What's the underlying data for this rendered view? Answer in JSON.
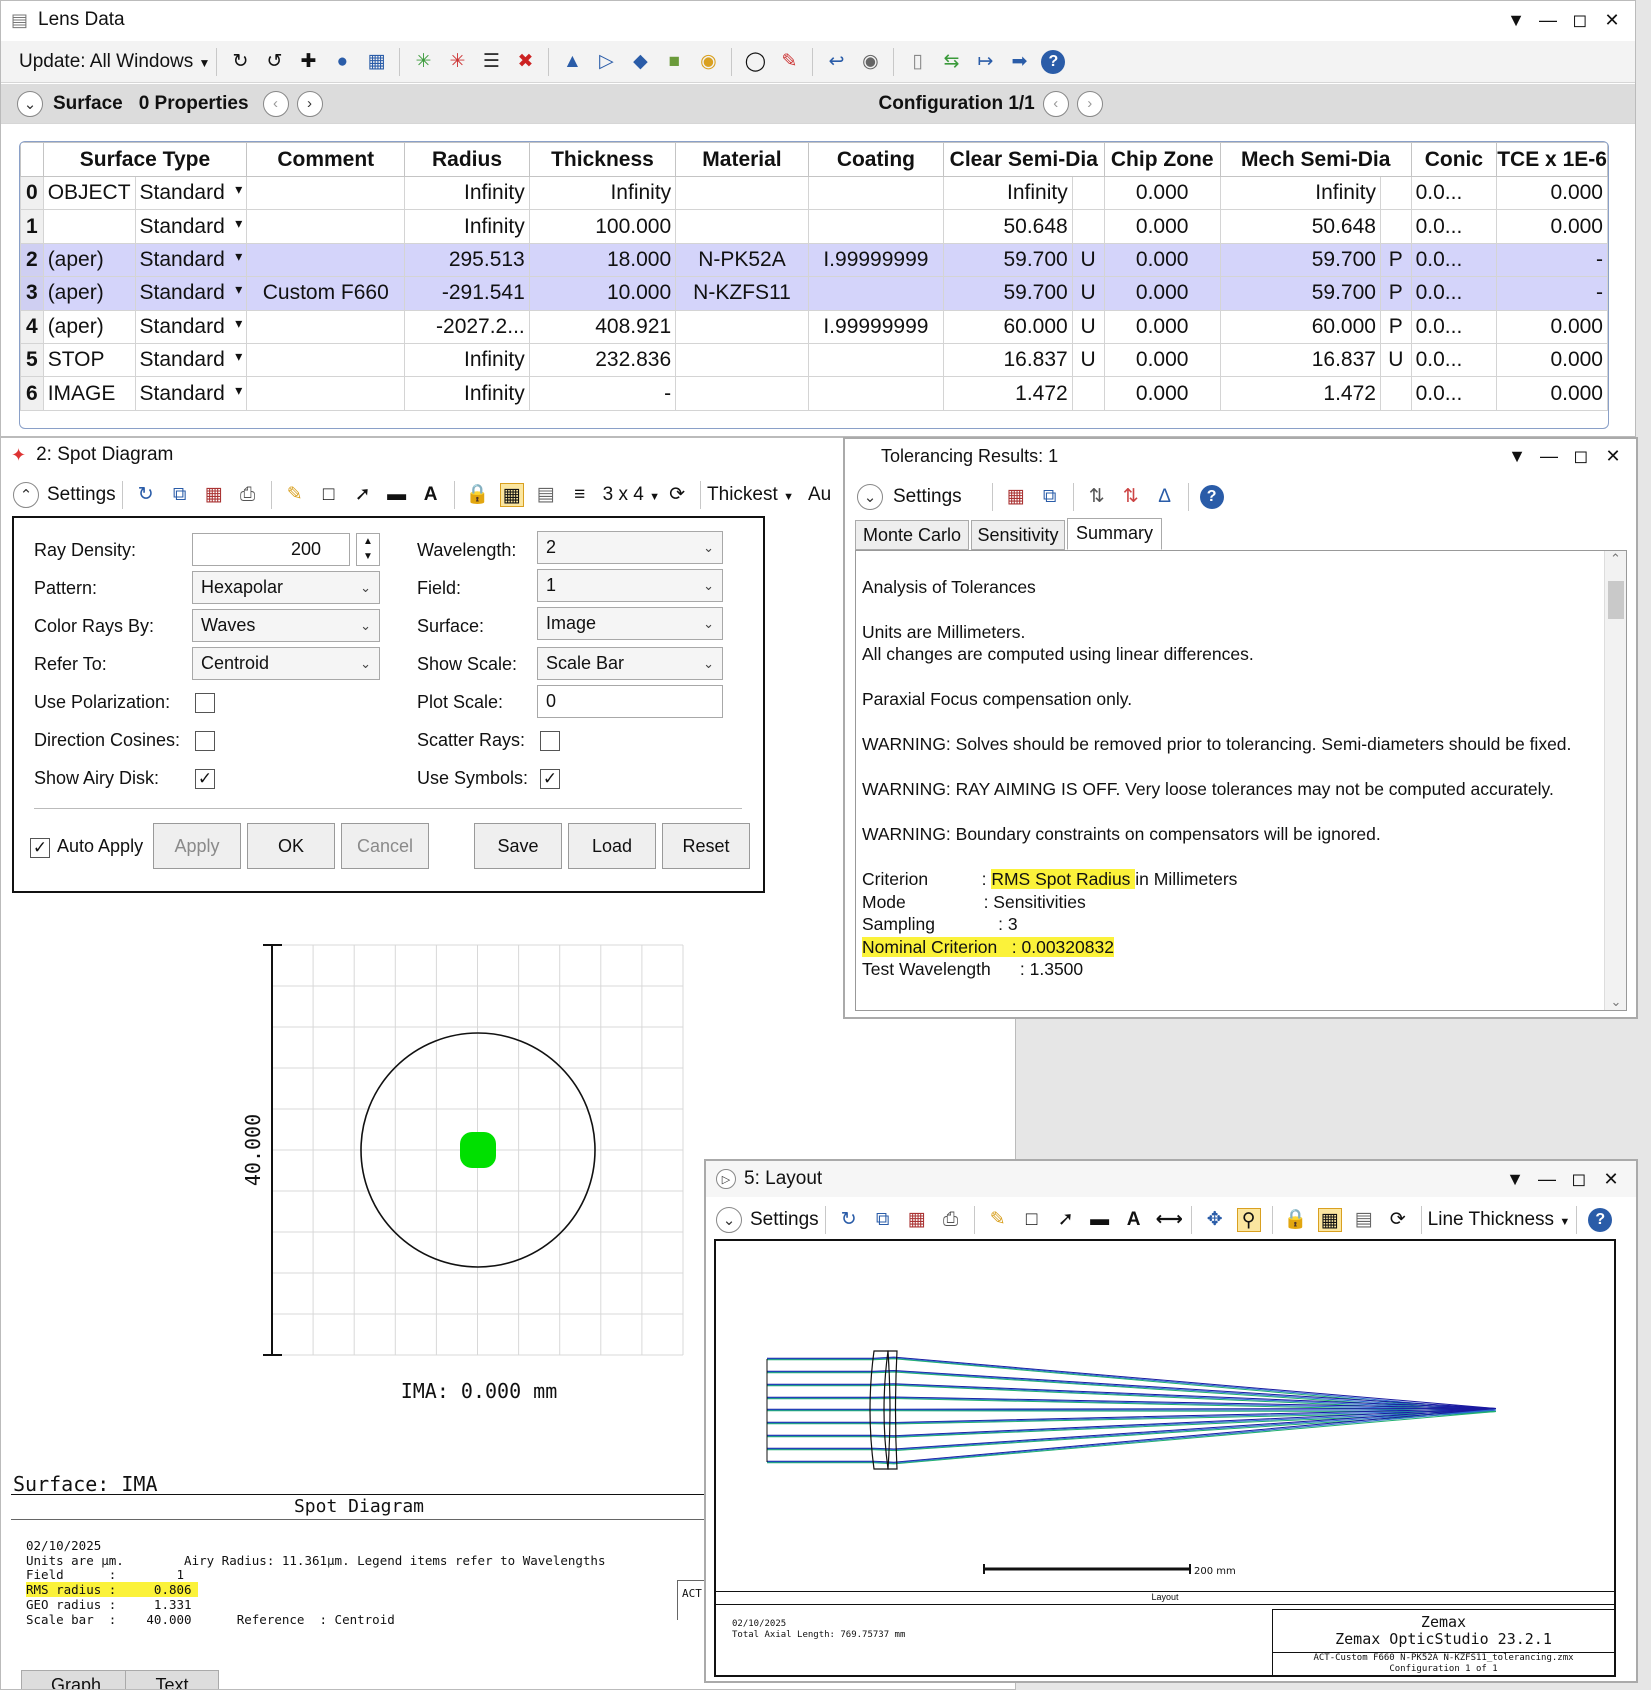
{
  "lens": {
    "title": "Lens Data",
    "update_label": "Update: All Windows",
    "surface_label": "Surface",
    "properties_label": "0 Properties",
    "configuration": "Configuration 1/1",
    "headers": [
      "Surface Type",
      "Comment",
      "Radius",
      "Thickness",
      "Material",
      "Coating",
      "Clear Semi-Dia",
      "Chip Zone",
      "Mech Semi-Dia",
      "Conic",
      "TCE x 1E-6"
    ],
    "rows": [
      {
        "idx": "0",
        "name": "OBJECT",
        "type": "Standard",
        "comment": "",
        "radius": "Infinity",
        "thickness": "Infinity",
        "material": "",
        "coating": "",
        "clear": "Infinity",
        "clear_flag": "",
        "chip": "0.000",
        "mech": "Infinity",
        "mech_flag": "",
        "conic": "0.0...",
        "tce": "0.000"
      },
      {
        "idx": "1",
        "name": "",
        "type": "Standard",
        "comment": "",
        "radius": "Infinity",
        "thickness": "100.000",
        "material": "",
        "coating": "",
        "clear": "50.648",
        "clear_flag": "",
        "chip": "0.000",
        "mech": "50.648",
        "mech_flag": "",
        "conic": "0.0...",
        "tce": "0.000"
      },
      {
        "idx": "2",
        "name": "(aper)",
        "type": "Standard",
        "comment": "",
        "radius": "295.513",
        "thickness": "18.000",
        "material": "N-PK52A",
        "coating": "I.99999999",
        "clear": "59.700",
        "clear_flag": "U",
        "chip": "0.000",
        "mech": "59.700",
        "mech_flag": "P",
        "conic": "0.0...",
        "tce": "-"
      },
      {
        "idx": "3",
        "name": "(aper)",
        "type": "Standard",
        "comment": "Custom F660",
        "radius": "-291.541",
        "thickness": "10.000",
        "material": "N-KZFS11",
        "coating": "",
        "clear": "59.700",
        "clear_flag": "U",
        "chip": "0.000",
        "mech": "59.700",
        "mech_flag": "P",
        "conic": "0.0...",
        "tce": "-"
      },
      {
        "idx": "4",
        "name": "(aper)",
        "type": "Standard",
        "comment": "",
        "radius": "-2027.2...",
        "thickness": "408.921",
        "material": "",
        "coating": "I.99999999",
        "clear": "60.000",
        "clear_flag": "U",
        "chip": "0.000",
        "mech": "60.000",
        "mech_flag": "P",
        "conic": "0.0...",
        "tce": "0.000"
      },
      {
        "idx": "5",
        "name": "STOP",
        "type": "Standard",
        "comment": "",
        "radius": "Infinity",
        "thickness": "232.836",
        "material": "",
        "coating": "",
        "clear": "16.837",
        "clear_flag": "U",
        "chip": "0.000",
        "mech": "16.837",
        "mech_flag": "U",
        "conic": "0.0...",
        "tce": "0.000"
      },
      {
        "idx": "6",
        "name": "IMAGE",
        "type": "Standard",
        "comment": "",
        "radius": "Infinity",
        "thickness": "-",
        "material": "",
        "coating": "",
        "clear": "1.472",
        "clear_flag": "",
        "chip": "0.000",
        "mech": "1.472",
        "mech_flag": "",
        "conic": "0.0...",
        "tce": "0.000"
      }
    ]
  },
  "spot": {
    "title": "2: Spot Diagram",
    "settings_label": "Settings",
    "grid_label": "3 x 4",
    "thickest_label": "Thickest",
    "au_label": "Au",
    "ray_density_label": "Ray Density:",
    "ray_density": "200",
    "pattern_label": "Pattern:",
    "pattern": "Hexapolar",
    "color_label": "Color Rays By:",
    "color": "Waves",
    "refer_label": "Refer To:",
    "refer": "Centroid",
    "polarization_label": "Use Polarization:",
    "direction_label": "Direction Cosines:",
    "airy_label": "Show Airy Disk:",
    "wavelength_label": "Wavelength:",
    "wavelength": "2",
    "field_label": "Field:",
    "field": "1",
    "surface_label": "Surface:",
    "surface": "Image",
    "show_scale_label": "Show Scale:",
    "show_scale": "Scale Bar",
    "plot_scale_label": "Plot Scale:",
    "plot_scale": "0",
    "scatter_label": "Scatter Rays:",
    "symbols_label": "Use Symbols:",
    "auto_apply": "Auto Apply",
    "apply": "Apply",
    "ok": "OK",
    "cancel": "Cancel",
    "save": "Save",
    "load": "Load",
    "reset": "Reset",
    "y_scale": "40.000",
    "ima_label": "IMA: 0.000 mm",
    "surface_caption": "Surface: IMA",
    "footer_title": "Spot Diagram",
    "date": "02/10/2025",
    "units_line": "Units are µm.        Airy Radius: 11.361µm. Legend items refer to Wavelengths",
    "field_line": "Field      :        1",
    "rms_line": "RMS radius :     0.806",
    "geo_line": "GEO radius :     1.331",
    "scale_line": "Scale bar  :    40.000      Reference  : Centroid",
    "act_label": "ACT",
    "tab_graph": "Graph",
    "tab_text": "Text",
    "spot_color": "#00e000"
  },
  "tol": {
    "title": "Tolerancing Results: 1",
    "settings_label": "Settings",
    "tabs": [
      "Monte Carlo",
      "Sensitivity",
      "Summary"
    ],
    "l1": "Analysis of Tolerances",
    "l2": "Units are Millimeters.",
    "l3": "All changes are computed using linear differences.",
    "l4": "Paraxial Focus compensation only.",
    "l5": "WARNING: Solves should be removed prior to tolerancing. Semi-diameters should be fixed.",
    "l6": "WARNING: RAY AIMING IS OFF. Very loose tolerances may not be computed accurately.",
    "l7": "WARNING: Boundary constraints on compensators will be ignored.",
    "crit_pre": "Criterion           : ",
    "crit_hl": "RMS Spot Radius ",
    "crit_post": "in Millimeters",
    "mode": "Mode                : Sensitivities",
    "sampling": "Sampling             : 3",
    "nominal": "Nominal Criterion   : 0.00320832",
    "testwl": "Test Wavelength      : 1.3500"
  },
  "layout": {
    "title": "5: Layout",
    "settings_label": "Settings",
    "line_thickness": "Line Thickness",
    "scale_text": "200 mm",
    "caption": "Layout",
    "date": "02/10/2025",
    "axial": "Total Axial Length:  769.75737 mm",
    "brand": "Zemax",
    "product": "Zemax OpticStudio 23.2.1",
    "file": "ACT-Custom F660 N-PK52A N-KZFS11_tolerancing.zmx",
    "config": "Configuration 1 of 1"
  }
}
